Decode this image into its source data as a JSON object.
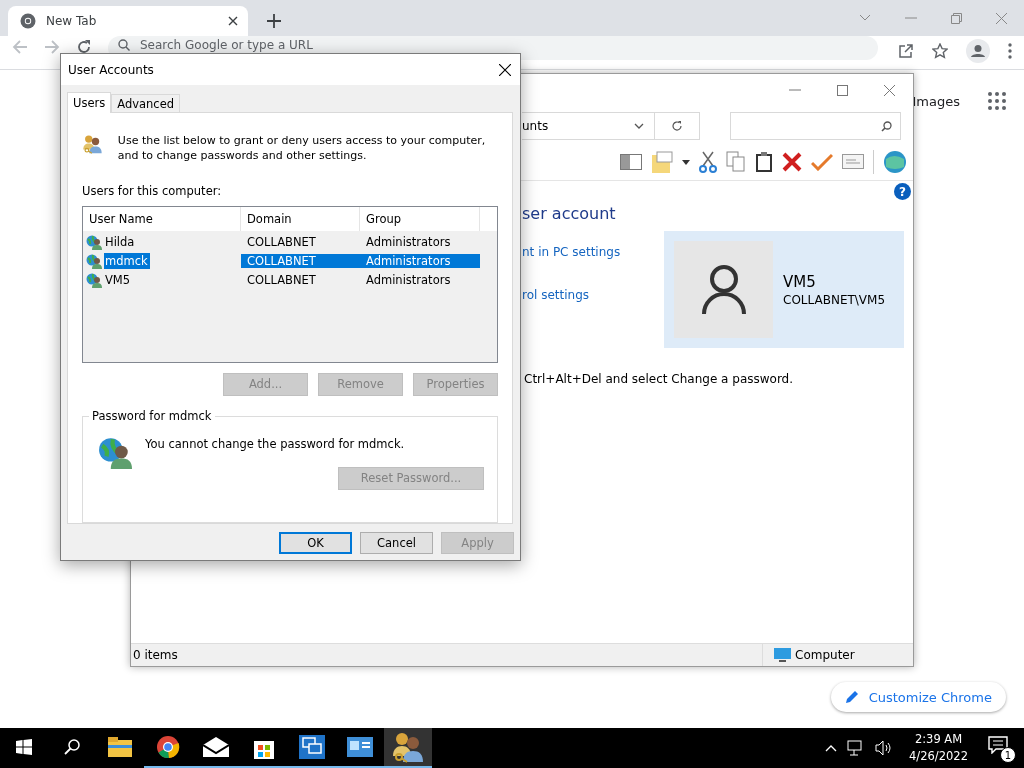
{
  "browser": {
    "tab": {
      "title": "New Tab",
      "selected": true
    },
    "omnibox": {
      "placeholder": "Search Google or type a URL"
    },
    "images_link": "Images",
    "customize_button": "Customize Chrome"
  },
  "explorer": {
    "address": "unts",
    "help": "?",
    "heading": "ser account",
    "links": [
      "nt in PC settings",
      "rol settings"
    ],
    "account": {
      "name": "VM5",
      "domain_user": "COLLABNET\\VM5"
    },
    "note": "Ctrl+Alt+Del and select Change a password.",
    "status_bar": {
      "items": "0 items",
      "zone": "Computer"
    }
  },
  "dialog": {
    "title": "User Accounts",
    "tabs": [
      {
        "label": "Users",
        "selected": true
      },
      {
        "label": "Advanced",
        "selected": false
      }
    ],
    "intro": "Use the list below to grant or deny users access to your computer, and to change passwords and other settings.",
    "list_label": "Users for this computer:",
    "columns": [
      "User Name",
      "Domain",
      "Group"
    ],
    "rows": [
      {
        "cells": [
          "Hilda",
          "COLLABNET",
          "Administrators"
        ],
        "selected": false
      },
      {
        "cells": [
          "mdmck",
          "COLLABNET",
          "Administrators"
        ],
        "selected": true
      },
      {
        "cells": [
          "VM5",
          "COLLABNET",
          "Administrators"
        ],
        "selected": false
      }
    ],
    "list_buttons": [
      {
        "label": "Add...",
        "disabled": true
      },
      {
        "label": "Remove",
        "disabled": true
      },
      {
        "label": "Properties",
        "disabled": true
      }
    ],
    "password_group": {
      "title": "Password for mdmck",
      "message": "You cannot change the password for mdmck.",
      "button": {
        "label": "Reset Password...",
        "disabled": true
      }
    },
    "buttons": [
      {
        "label": "OK",
        "default": true,
        "disabled": false
      },
      {
        "label": "Cancel",
        "default": false,
        "disabled": false
      },
      {
        "label": "Apply",
        "default": false,
        "disabled": true
      }
    ]
  },
  "taskbar": {
    "apps": [
      {
        "kind": "explorer",
        "running": false,
        "active": false
      },
      {
        "kind": "chrome",
        "running": true,
        "active": false
      },
      {
        "kind": "mail",
        "running": true,
        "active": false
      },
      {
        "kind": "store",
        "running": true,
        "active": false
      },
      {
        "kind": "remote",
        "running": true,
        "active": false
      },
      {
        "kind": "control",
        "running": true,
        "active": false
      },
      {
        "kind": "users",
        "running": true,
        "active": true
      }
    ],
    "clock": {
      "time": "2:39 AM",
      "date": "4/26/2022"
    },
    "notifications": "1"
  }
}
